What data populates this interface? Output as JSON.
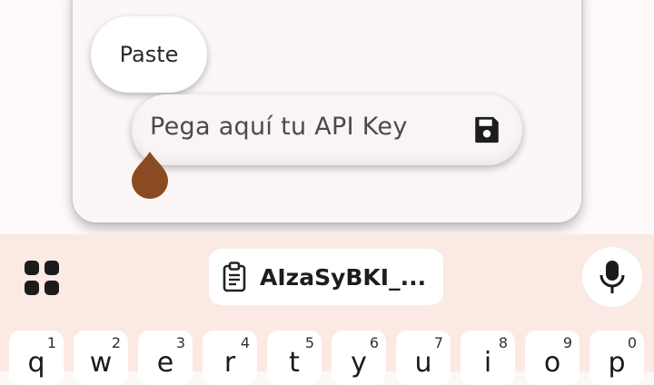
{
  "context_menu": {
    "paste_label": "Paste"
  },
  "api_key_input": {
    "placeholder": "Pega aquí tu API Key",
    "save_icon": "save-icon"
  },
  "keyboard": {
    "apps_icon": "grid-apps-icon",
    "clipboard_suggestion": "AIzaSyBKI_...",
    "clipboard_icon": "clipboard-icon",
    "mic_icon": "mic-icon",
    "keys": [
      {
        "char": "q",
        "hint": "1"
      },
      {
        "char": "w",
        "hint": "2"
      },
      {
        "char": "e",
        "hint": "3"
      },
      {
        "char": "r",
        "hint": "4"
      },
      {
        "char": "t",
        "hint": "5"
      },
      {
        "char": "y",
        "hint": "6"
      },
      {
        "char": "u",
        "hint": "7"
      },
      {
        "char": "i",
        "hint": "8"
      },
      {
        "char": "o",
        "hint": "9"
      },
      {
        "char": "p",
        "hint": "0"
      }
    ]
  },
  "colors": {
    "keyboard_bg": "#fbe9e4",
    "cursor_handle": "#8a4a22",
    "dialog_bg": "#fdf6f7"
  }
}
